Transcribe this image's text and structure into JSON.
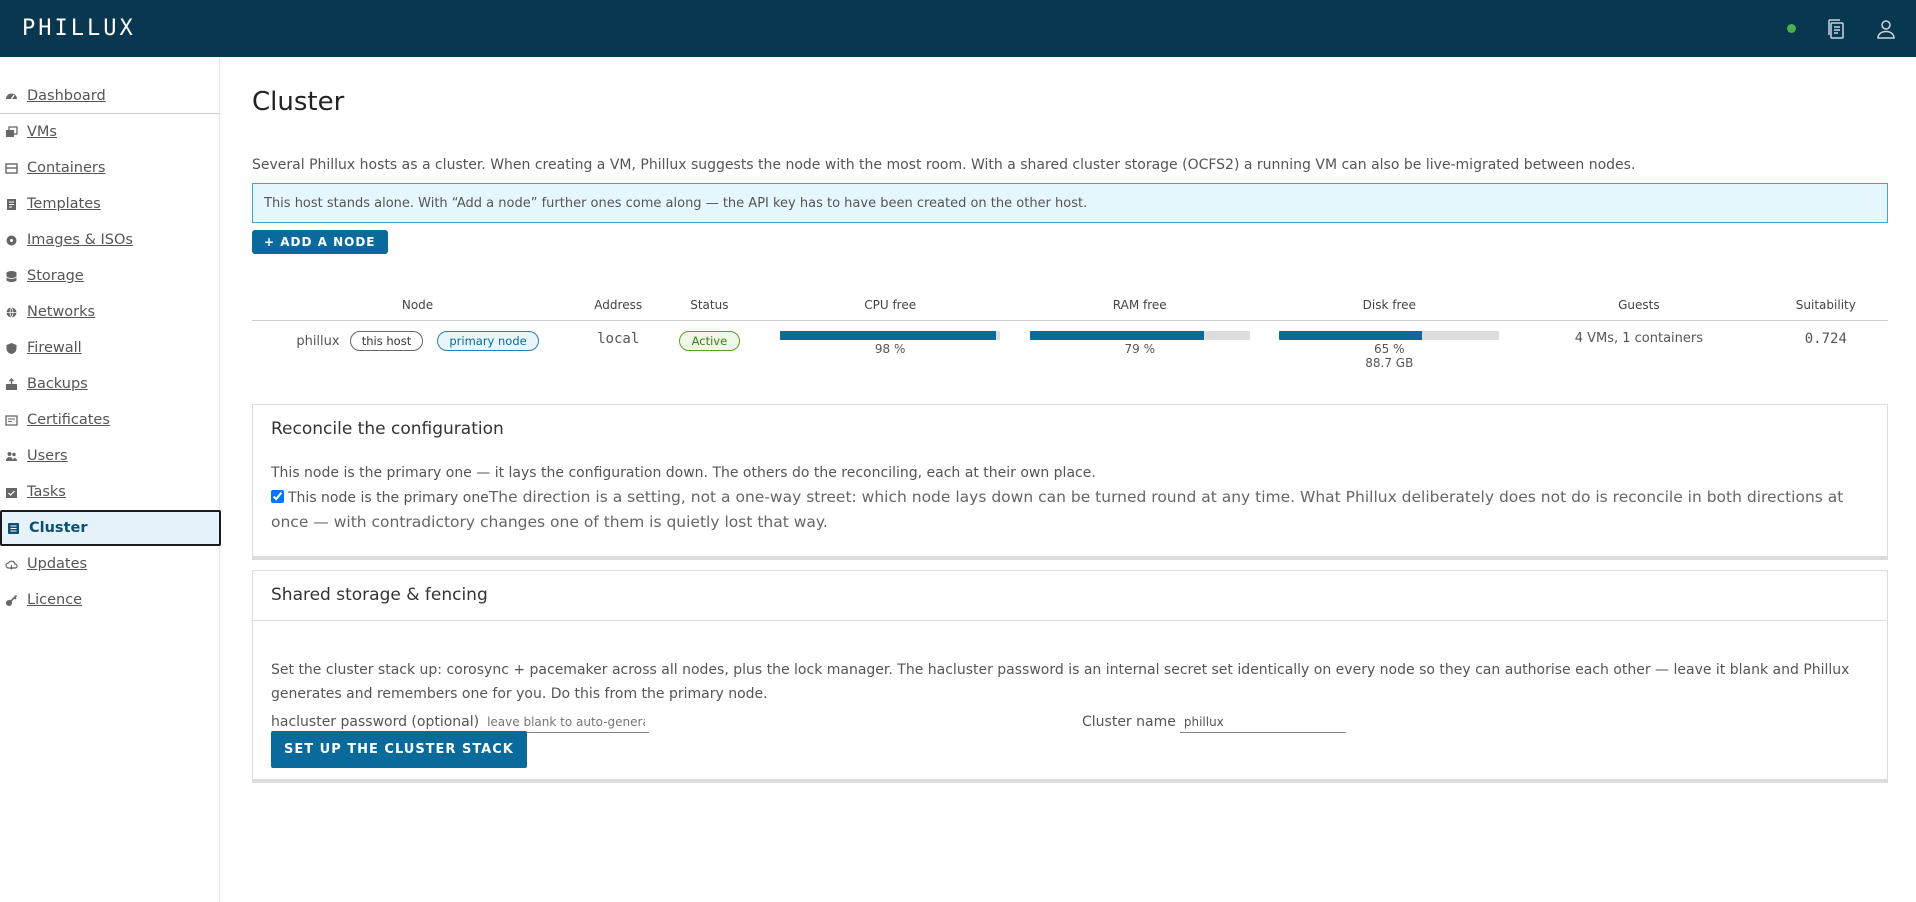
{
  "header": {
    "logo": "PHILLUX",
    "status_color": "#4caf50"
  },
  "sidebar": {
    "items": [
      {
        "label": "Dashboard",
        "icon": "dashboard-icon"
      },
      {
        "label": "VMs",
        "icon": "vm-icon"
      },
      {
        "label": "Containers",
        "icon": "container-icon"
      },
      {
        "label": "Templates",
        "icon": "template-icon"
      },
      {
        "label": "Images & ISOs",
        "icon": "disc-icon"
      },
      {
        "label": "Storage",
        "icon": "database-icon"
      },
      {
        "label": "Networks",
        "icon": "network-icon"
      },
      {
        "label": "Firewall",
        "icon": "shield-icon"
      },
      {
        "label": "Backups",
        "icon": "backup-icon"
      },
      {
        "label": "Certificates",
        "icon": "certificate-icon"
      },
      {
        "label": "Users",
        "icon": "users-icon"
      },
      {
        "label": "Tasks",
        "icon": "tasks-icon"
      },
      {
        "label": "Cluster",
        "icon": "cluster-icon",
        "active": true
      },
      {
        "label": "Updates",
        "icon": "cloud-icon"
      },
      {
        "label": "Licence",
        "icon": "key-icon"
      }
    ]
  },
  "main": {
    "title": "Cluster",
    "intro": "Several Phillux hosts as a cluster. When creating a VM, Phillux suggests the node with the most room. With a shared cluster storage (OCFS2) a running VM can also be live-migrated between nodes.",
    "info": "This host stands alone. With “Add a node” further ones come along — the API key has to have been created on the other host.",
    "add_button": "+ ADD A NODE",
    "table": {
      "headers": [
        "Node",
        "Address",
        "Status",
        "CPU free",
        "RAM free",
        "Disk free",
        "Guests",
        "Suitability"
      ],
      "row": {
        "node": "phillux",
        "this_host": "this host",
        "primary": "primary node",
        "address": "local",
        "status": "Active",
        "cpu_free": 0.98,
        "cpu_label": "98 %",
        "ram_free": 0.79,
        "ram_label": "79 %",
        "disk_free": 0.65,
        "disk_label": "65 %",
        "disk_size": "88.7 GB",
        "guests": "4 VMs, 1 containers",
        "suitability": "0.724"
      }
    },
    "reconcile": {
      "title": "Reconcile the configuration",
      "desc": "This node is the primary one — it lays the configuration down. The others do the reconciling, each at their own place.",
      "checkbox_label": "This node is the primary one",
      "checkbox_checked": true,
      "note": "The direction is a setting, not a one-way street: which node lays down can be turned round at any time. What Phillux deliberately does not do is reconcile in both directions at once — with contradictory changes one of them is quietly lost that way."
    },
    "fencing": {
      "title": "Shared storage & fencing",
      "desc": "Set the cluster stack up: corosync + pacemaker across all nodes, plus the lock manager. The hacluster password is an internal secret set identically on every node so they can authorise each other — leave it blank and Phillux generates and remembers one for you. Do this from the primary node.",
      "pw_label": "hacluster password (optional)",
      "pw_placeholder": "leave blank to auto-generate",
      "name_label": "Cluster name",
      "name_value": "phillux",
      "setup_button": "SET UP THE CLUSTER STACK"
    }
  }
}
